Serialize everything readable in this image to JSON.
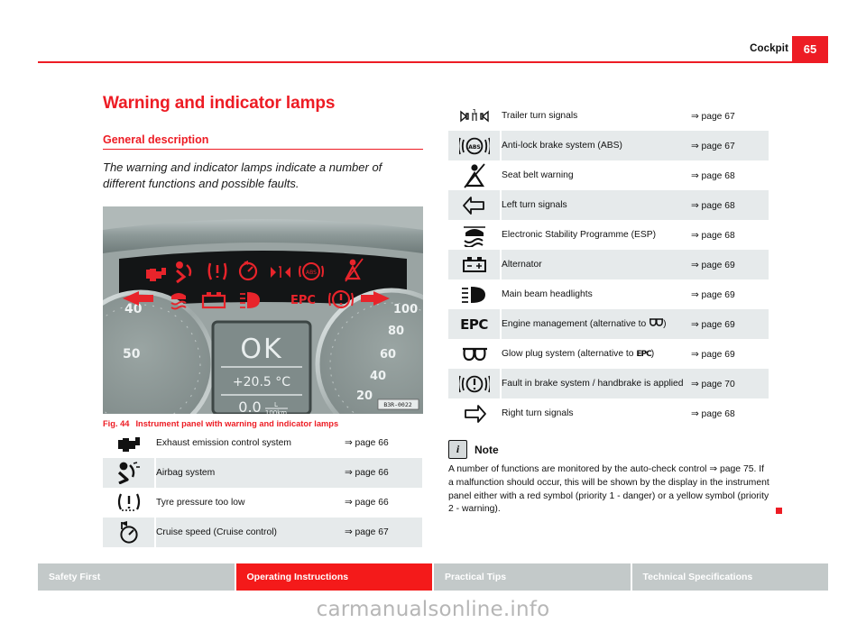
{
  "header": {
    "chapter": "Cockpit",
    "page_number": "65"
  },
  "content": {
    "main_title": "Warning and indicator lamps",
    "sub_title": "General description",
    "intro": "The warning and indicator lamps indicate a number of different functions and possible faults."
  },
  "figure": {
    "label": "Fig. 44",
    "caption": "Instrument panel with warning and indicator lamps",
    "image_code": "B3R-0022",
    "display": {
      "status": "OK",
      "temperature": "+20.5 °C",
      "consumption_value": "0.0",
      "consumption_unit_top": "L",
      "consumption_unit_bottom": "100km"
    },
    "left_gauge_ticks": [
      "40",
      "50"
    ],
    "right_gauge_ticks": [
      "100",
      "80",
      "60",
      "40",
      "20"
    ],
    "cluster_lamp_labels": [
      "EPC"
    ]
  },
  "left_table": {
    "rows": [
      {
        "icon": "engine-icon",
        "description": "Exhaust emission control system",
        "page_ref": "⇒ page 66"
      },
      {
        "icon": "airbag-icon",
        "description": "Airbag system",
        "page_ref": "⇒ page 66"
      },
      {
        "icon": "tyre-pressure-icon",
        "description": "Tyre pressure too low",
        "page_ref": "⇒ page 66"
      },
      {
        "icon": "cruise-control-icon",
        "description": "Cruise speed (Cruise control)",
        "page_ref": "⇒ page 67"
      }
    ]
  },
  "right_table": {
    "rows": [
      {
        "icon": "trailer-turn-signal-icon",
        "description": "Trailer turn signals",
        "page_ref": "⇒ page 67"
      },
      {
        "icon": "abs-icon",
        "description": "Anti-lock brake system (ABS)",
        "page_ref": "⇒ page 67"
      },
      {
        "icon": "seat-belt-icon",
        "description": "Seat belt warning",
        "page_ref": "⇒ page 68"
      },
      {
        "icon": "left-turn-signal-icon",
        "description": "Left turn signals",
        "page_ref": "⇒ page 68"
      },
      {
        "icon": "esp-icon",
        "description": "Electronic Stability Programme (ESP)",
        "page_ref": "⇒ page 68"
      },
      {
        "icon": "alternator-icon",
        "description": "Alternator",
        "page_ref": "⇒ page 69"
      },
      {
        "icon": "main-beam-icon",
        "description": "Main beam headlights",
        "page_ref": "⇒ page 69"
      },
      {
        "icon": "epc-icon",
        "description_pre": "Engine management (alternative to ",
        "description_post": ")",
        "inline_icon": "glow-plug-icon",
        "page_ref": "⇒ page 69"
      },
      {
        "icon": "glow-plug-icon",
        "description_pre": "Glow plug system (alternative to ",
        "description_post": ")",
        "inline_icon": "epc-icon",
        "page_ref": "⇒ page 69"
      },
      {
        "icon": "brake-fault-icon",
        "description": "Fault in brake system / handbrake is applied",
        "page_ref": "⇒ page 70"
      },
      {
        "icon": "right-turn-signal-icon",
        "description": "Right turn signals",
        "page_ref": "⇒ page 68"
      }
    ]
  },
  "note": {
    "icon": "info-icon",
    "title": "Note",
    "body": "A number of functions are monitored by the auto-check control ⇒ page 75. If a malfunction should occur, this will be shown by the display in the instrument panel either with a red symbol (priority 1 - danger) or a yellow symbol (priority 2 - warning)."
  },
  "footer": {
    "tabs": [
      {
        "label": "Safety First",
        "active": false
      },
      {
        "label": "Operating Instructions",
        "active": true
      },
      {
        "label": "Practical Tips",
        "active": false
      },
      {
        "label": "Technical Specifications",
        "active": false
      }
    ]
  },
  "watermark": "carmanualsonline.info",
  "colors": {
    "accent_red": "#ED1C24",
    "footer_active": "#F41A1A",
    "footer_inactive": "#c3c9c9",
    "row_shade": "#e6eaeb"
  }
}
